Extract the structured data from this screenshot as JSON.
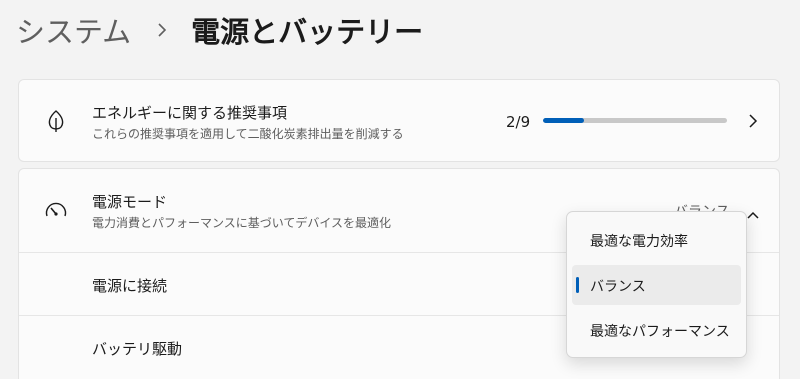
{
  "breadcrumb": {
    "parent": "システム",
    "current": "電源とバッテリー"
  },
  "recommendations": {
    "title": "エネルギーに関する推奨事項",
    "subtitle": "これらの推奨事項を適用して二酸化炭素排出量を削減する",
    "progress_text": "2/9",
    "progress_fraction": 0.222,
    "icon": "leaf-icon"
  },
  "power_mode": {
    "title": "電源モード",
    "subtitle": "電力消費とパフォーマンスに基づいてデバイスを最適化",
    "value": "バランス",
    "icon": "speedometer-icon",
    "rows": [
      {
        "label": "電源に接続"
      },
      {
        "label": "バッテリ駆動"
      }
    ],
    "options": [
      {
        "label": "最適な電力効率",
        "selected": false
      },
      {
        "label": "バランス",
        "selected": true
      },
      {
        "label": "最適なパフォーマンス",
        "selected": false
      }
    ]
  },
  "colors": {
    "accent": "#005fb8",
    "background": "#f3f3f3",
    "card": "#fbfbfb"
  }
}
